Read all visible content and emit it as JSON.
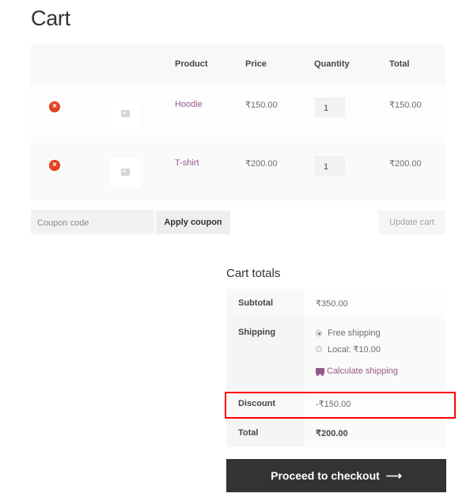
{
  "page": {
    "title": "Cart"
  },
  "cart": {
    "headers": {
      "product": "Product",
      "price": "Price",
      "quantity": "Quantity",
      "total": "Total"
    },
    "items": [
      {
        "name": "Hoodie",
        "price": "₹150.00",
        "quantity": "1",
        "total": "₹150.00",
        "remove_icon": "×"
      },
      {
        "name": "T-shirt",
        "price": "₹200.00",
        "quantity": "1",
        "total": "₹200.00",
        "remove_icon": "×"
      }
    ],
    "coupon": {
      "placeholder": "Coupon code",
      "value": "",
      "apply_label": "Apply coupon"
    },
    "update_label": "Update cart"
  },
  "totals": {
    "title": "Cart totals",
    "subtotal_label": "Subtotal",
    "subtotal_value": "₹350.00",
    "shipping_label": "Shipping",
    "shipping_options": [
      {
        "label": "Free shipping",
        "selected": true
      },
      {
        "label": "Local: ₹10.00",
        "selected": false
      }
    ],
    "calculate_shipping": "Calculate shipping",
    "discount_label": "Discount",
    "discount_value": "-₹150.00",
    "total_label": "Total",
    "total_value": "₹200.00"
  },
  "checkout": {
    "label": "Proceed to checkout",
    "arrow": "⟶"
  },
  "colors": {
    "link": "#96588a",
    "remove": "#e2401c",
    "checkout_bg": "#333333",
    "highlight": "#ff0000"
  }
}
